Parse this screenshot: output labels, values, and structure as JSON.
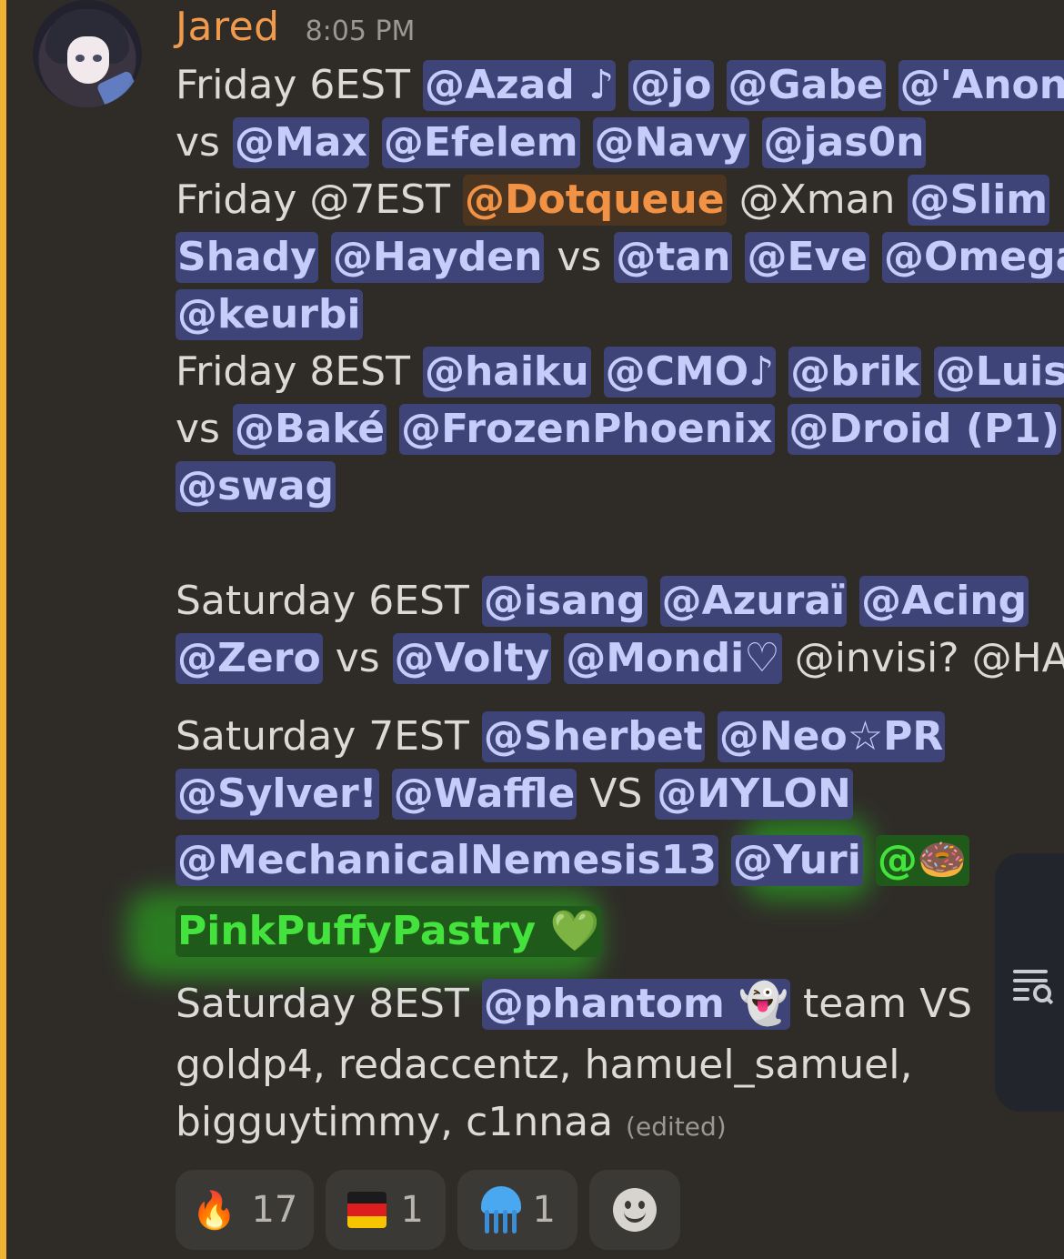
{
  "message": {
    "author": "Jared",
    "timestamp": "8:05 PM",
    "author_color": "#f29a4c",
    "edited_label": "(edited)",
    "lines": {
      "l1_text": "Friday 6EST",
      "l1_m1": "@Azad ♪",
      "l1_m2": "@jo",
      "l1_m3": "@Gabe",
      "l1_m4": "@'Anon'",
      "l2_vs": "vs",
      "l2_m1": "@Max",
      "l2_m2": "@Efelem",
      "l2_m3": "@Navy",
      "l2_m4": "@jas0n",
      "l3_text": "Friday @7EST",
      "l3_m1": "@Dotqueue",
      "l3_text2": "@Xman",
      "l3_m2": "@Slim",
      "l4_m1": "Shady",
      "l4_m2": "@Hayden",
      "l4_vs": "vs",
      "l4_m3": "@tan",
      "l4_m4": "@Eve",
      "l4_m5": "@Omega",
      "l5_m1": "@keurbi",
      "l6_text": "Friday 8EST",
      "l6_m1": "@haiku",
      "l6_m2": "@CMO♪",
      "l6_m3": "@brik",
      "l6_m4": "@Luis!",
      "l7_vs": "vs",
      "l7_m1": "@Baké",
      "l7_m2": "@FrozenPhoenix",
      "l7_m3": "@Droid (P1)",
      "l8_m1": "@swag",
      "l9_text": "Saturday 6EST",
      "l9_m1": "@isang",
      "l9_m2": "@Azuraï",
      "l9_m3": "@Acing",
      "l10_m1": "@Zero",
      "l10_vs": "vs",
      "l10_m2": "@Volty",
      "l10_m3": "@Mondi♡",
      "l10_text": "@invisi? @HAZ",
      "l11_text": "Saturday 7EST",
      "l11_m1": "@Sherbet",
      "l11_m2": "@Neo☆PR",
      "l12_m1": "@Sylver!",
      "l12_m2": "@Waffle",
      "l12_vs": "VS",
      "l12_m3": "@ИYLON",
      "l13_m1": "@MechanicalNemesis13",
      "l13_m2": "@Yuri",
      "l13_m3": "@🍩",
      "l14_m1": "PinkPuffyPastry 💚",
      "l15_text": "Saturday 8EST",
      "l15_m1": "@phantom 👻",
      "l15_text2": "team  VS",
      "l16_text": "goldp4, redaccentz, hamuel_samuel,",
      "l17_text": "bigguytimmy, c1nnaa"
    }
  },
  "reactions": [
    {
      "emoji": "🔥",
      "count": "17"
    },
    {
      "emoji": "german-flag-icon",
      "count": "1"
    },
    {
      "emoji": "jellyfish-icon",
      "count": "1"
    }
  ],
  "colors": {
    "mention_bg": "#3f4478",
    "mention_text": "#c6cdfb",
    "highlight_bar": "#f0b232",
    "role_green": "#44e23c",
    "role_orange": "#f29245"
  }
}
